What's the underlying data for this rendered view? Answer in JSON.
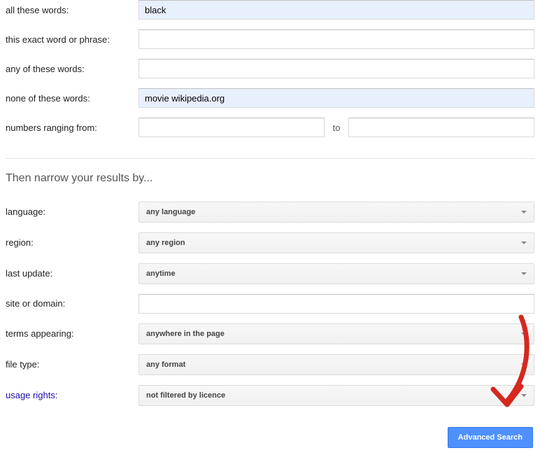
{
  "find": {
    "all_words": {
      "label": "all these words:",
      "value": "black"
    },
    "exact": {
      "label": "this exact word or phrase:",
      "value": ""
    },
    "any": {
      "label": "any of these words:",
      "value": ""
    },
    "none": {
      "label": "none of these words:",
      "value": "movie wikipedia.org"
    },
    "range": {
      "label": "numbers ranging from:",
      "from": "",
      "to_label": "to",
      "to": ""
    }
  },
  "narrow_heading": "Then narrow your results by...",
  "narrow": {
    "language": {
      "label": "language:",
      "value": "any language"
    },
    "region": {
      "label": "region:",
      "value": "any region"
    },
    "last_update": {
      "label": "last update:",
      "value": "anytime"
    },
    "site": {
      "label": "site or domain:",
      "value": ""
    },
    "terms": {
      "label": "terms appearing:",
      "value": "anywhere in the page"
    },
    "filetype": {
      "label": "file type:",
      "value": "any format"
    },
    "usage": {
      "label": "usage rights:",
      "value": "not filtered by licence"
    }
  },
  "button": "Advanced Search"
}
